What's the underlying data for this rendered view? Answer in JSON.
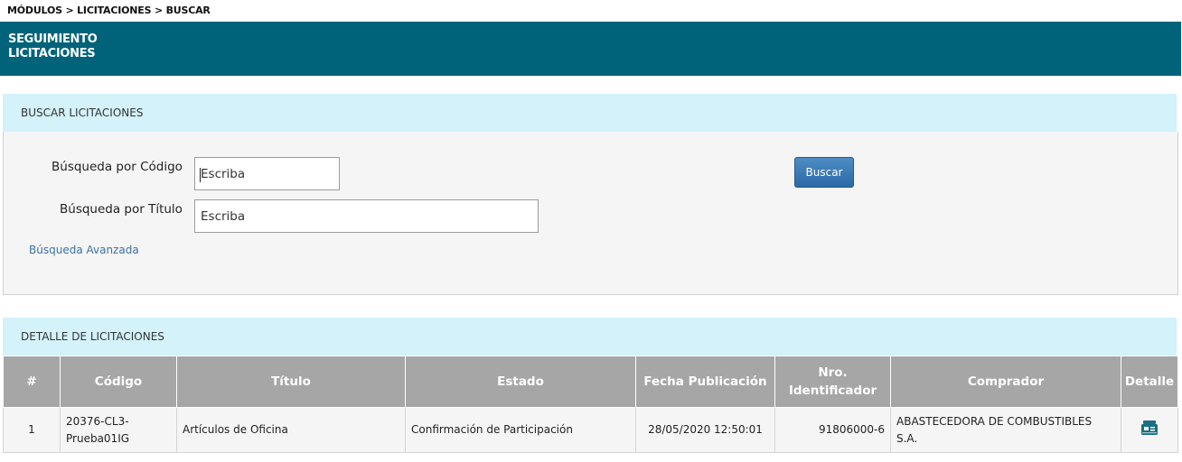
{
  "breadcrumb": "MÓDULOS > LICITACIONES > BUSCAR",
  "header": {
    "line1": "SEGUIMIENTO",
    "line2": "LICITACIONES"
  },
  "search": {
    "panel_title": "BUSCAR LICITACIONES",
    "codigo_label": "Búsqueda por Código",
    "codigo_placeholder": "Escriba",
    "titulo_label": "Búsqueda por Título",
    "titulo_placeholder": "Escriba",
    "button_label": "Buscar",
    "advanced_link": "Búsqueda Avanzada"
  },
  "results": {
    "panel_title": "DETALLE DE LICITACIONES",
    "columns": {
      "num": "#",
      "codigo": "Código",
      "titulo": "Título",
      "estado": "Estado",
      "fecha": "Fecha Publicación",
      "nro_line1": "Nro.",
      "nro_line2": "Identificador",
      "comprador": "Comprador",
      "detalle": "Detalle"
    },
    "rows": [
      {
        "num": "1",
        "codigo_line1": "20376-CL3-",
        "codigo_line2": "Prueba01IG",
        "titulo": "Artículos de Oficina",
        "estado": "Confirmación de Participación",
        "fecha": "28/05/2020 12:50:01",
        "nro": "91806000-6",
        "comprador": "ABASTECEDORA DE COMBUSTIBLES S.A.",
        "detalle_icon": "detail-folder-icon"
      }
    ]
  },
  "colors": {
    "header_bg": "#00637a",
    "panel_head_bg": "#d3f2fa",
    "table_head_bg": "#a6a6a6",
    "button_bg": "#3a7ab6",
    "icon": "#1b6f86"
  }
}
